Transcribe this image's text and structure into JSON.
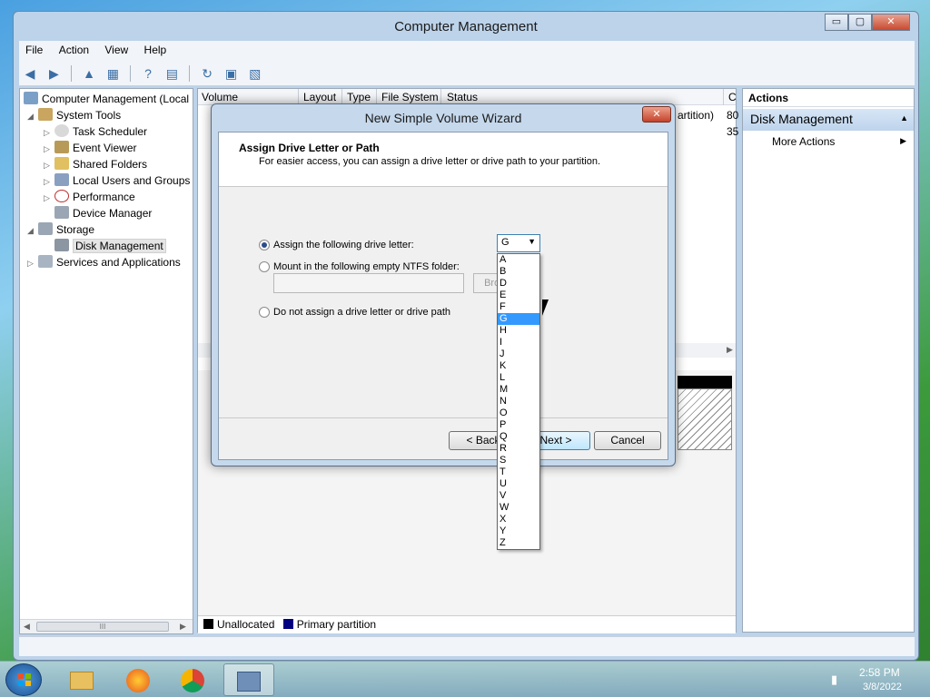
{
  "window": {
    "title": "Computer Management",
    "minimize": "▭",
    "maximize": "▢",
    "close": "✕"
  },
  "menu": [
    "File",
    "Action",
    "View",
    "Help"
  ],
  "tree": {
    "root": "Computer Management (Local",
    "system_tools": "System Tools",
    "task_scheduler": "Task Scheduler",
    "event_viewer": "Event Viewer",
    "shared_folders": "Shared Folders",
    "local_users": "Local Users and Groups",
    "performance": "Performance",
    "device_manager": "Device Manager",
    "storage": "Storage",
    "disk_management": "Disk Management",
    "services": "Services and Applications",
    "scroll_thumb": "III"
  },
  "columns": [
    "Volume",
    "Layout",
    "Type",
    "File System",
    "Status",
    "C"
  ],
  "row_fragments": [
    "artition)",
    "80",
    "35"
  ],
  "legend": {
    "unallocated": "Unallocated",
    "primary": "Primary partition"
  },
  "actions": {
    "header": "Actions",
    "section": "Disk Management",
    "more": "More Actions"
  },
  "wizard": {
    "title": "New Simple Volume Wizard",
    "close": "✕",
    "heading": "Assign Drive Letter or Path",
    "subheading": "For easier access, you can assign a drive letter or drive path to your partition.",
    "opt_assign": "Assign the following drive letter:",
    "opt_mount": "Mount in the following empty NTFS folder:",
    "opt_none": "Do not assign a drive letter or drive path",
    "browse": "Browse...",
    "back": "< Back",
    "next": "Next >",
    "cancel": "Cancel",
    "selected_letter": "G",
    "letters": [
      "A",
      "B",
      "D",
      "E",
      "F",
      "G",
      "H",
      "I",
      "J",
      "K",
      "L",
      "M",
      "N",
      "O",
      "P",
      "Q",
      "R",
      "S",
      "T",
      "U",
      "V",
      "W",
      "X",
      "Y",
      "Z"
    ]
  },
  "taskbar": {
    "time": "2:58 PM",
    "date": "3/8/2022"
  },
  "colors": {
    "accent": "#3399ff",
    "unallocated": "#000000",
    "primary": "#000080"
  }
}
